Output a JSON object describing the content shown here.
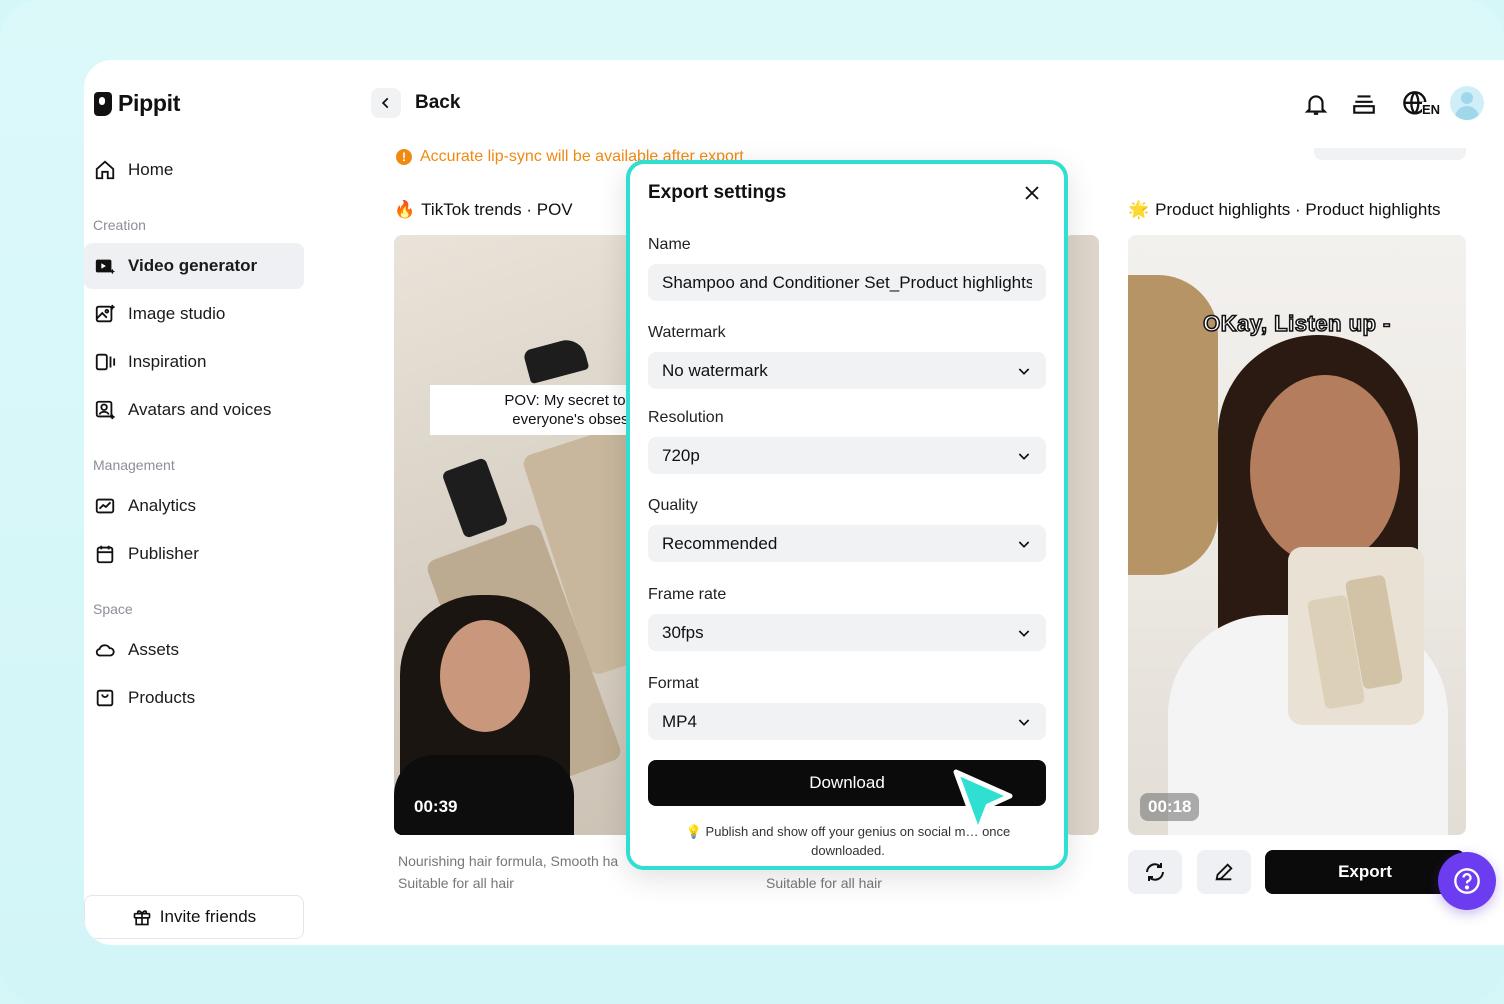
{
  "app": {
    "brand": "Pippit"
  },
  "sidebar": {
    "home": "Home",
    "sections": {
      "creation": "Creation",
      "management": "Management",
      "space": "Space"
    },
    "items": {
      "video_generator": "Video generator",
      "image_studio": "Image studio",
      "inspiration": "Inspiration",
      "avatars_voices": "Avatars and voices",
      "analytics": "Analytics",
      "publisher": "Publisher",
      "assets": "Assets",
      "products": "Products"
    },
    "invite": "Invite friends"
  },
  "header": {
    "back": "Back",
    "language_badge": "EN"
  },
  "notice": {
    "icon": "!",
    "text": "Accurate lip-sync will be available after export"
  },
  "cards": {
    "left": {
      "emoji": "🔥",
      "title": "TikTok trends · POV",
      "caption_line1": "POV: My secret to flawles",
      "caption_line2": "everyone's obsessed w",
      "duration": "00:39",
      "desc_line1": "Nourishing hair formula, Smooth ha",
      "desc_line2": "Suitable for all hair"
    },
    "middle": {
      "desc": "Suitable for all hair"
    },
    "right": {
      "emoji": "🌟",
      "title": "Product highlights · Product highlights",
      "overlay_text": "OKay, Listen up -",
      "duration": "00:18",
      "export": "Export"
    }
  },
  "modal": {
    "title": "Export settings",
    "name_label": "Name",
    "name_value": "Shampoo and Conditioner Set_Product highlights",
    "watermark_label": "Watermark",
    "watermark_value": "No watermark",
    "resolution_label": "Resolution",
    "resolution_value": "720p",
    "quality_label": "Quality",
    "quality_value": "Recommended",
    "framerate_label": "Frame rate",
    "framerate_value": "30fps",
    "format_label": "Format",
    "format_value": "MP4",
    "download": "Download",
    "publish_emoji": "💡",
    "publish_note": "Publish and show off your genius on social m… once downloaded."
  },
  "colors": {
    "accent_modal_border": "#2fe0d2",
    "notice": "#f08a12",
    "help": "#6c3cf0",
    "primary_button": "#0b0b0b"
  }
}
